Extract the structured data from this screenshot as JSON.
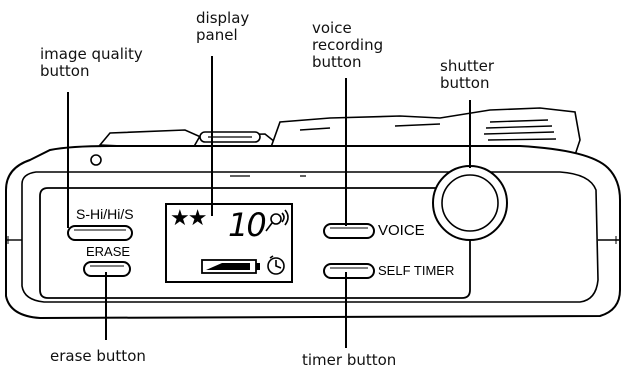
{
  "callouts": {
    "display_panel": [
      "display",
      "panel"
    ],
    "image_quality_button": [
      "image quality",
      "button"
    ],
    "voice_recording_button": [
      "voice",
      "recording",
      "button"
    ],
    "shutter_button": [
      "shutter",
      "button"
    ],
    "erase_button": "erase button",
    "timer_button": "timer button"
  },
  "camera_labels": {
    "quality_modes": "S-Hi/Hi/S",
    "erase": "ERASE",
    "voice": "VOICE",
    "self_timer": "SELF TIMER"
  },
  "lcd": {
    "stars": "★★",
    "count": "10",
    "mic_icon": "microphone-icon",
    "timer_icon": "self-timer-icon",
    "battery_icon": "battery-icon"
  }
}
